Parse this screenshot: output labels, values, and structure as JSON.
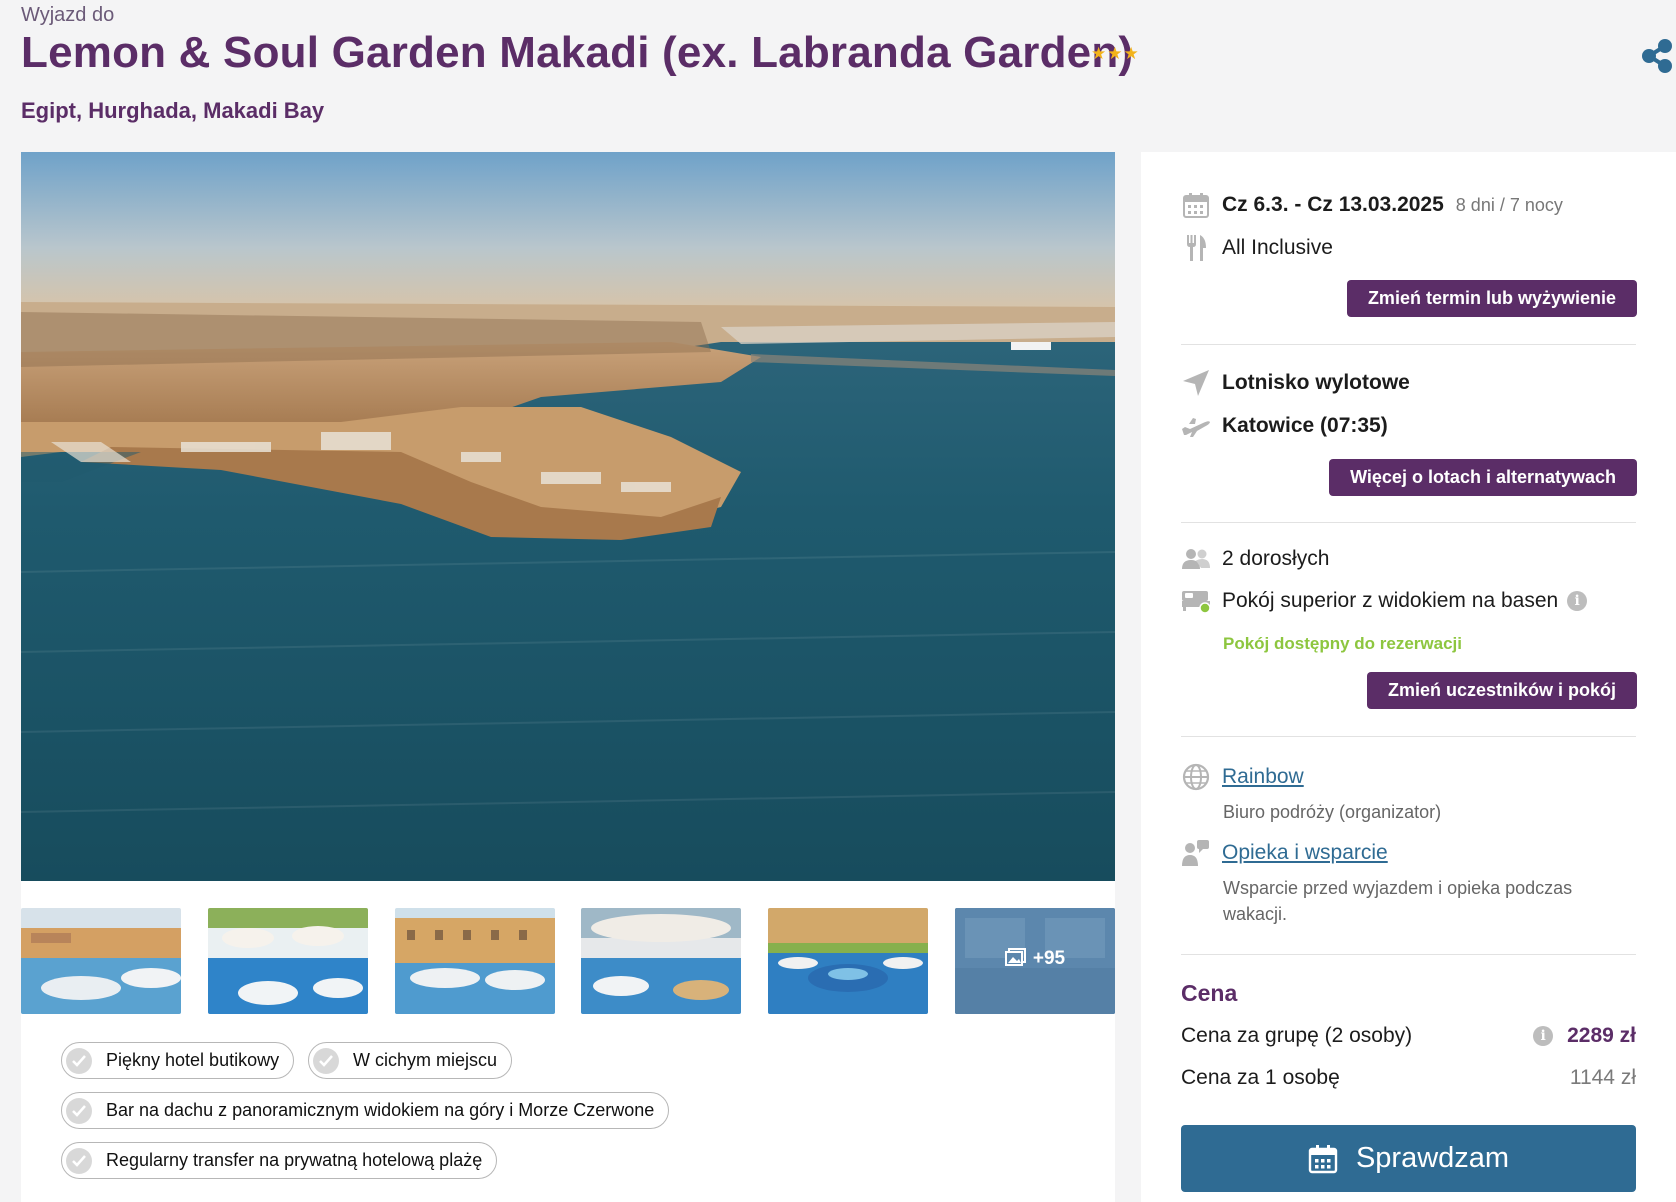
{
  "header": {
    "subtitle": "Wyjazd do",
    "title": "Lemon & Soul Garden Makadi (ex. Labranda Garden)",
    "stars": "★★★",
    "location": "Egipt, Hurghada, Makadi Bay",
    "share_icon": "share-icon"
  },
  "gallery": {
    "more_count": "+95",
    "tags": [
      "Piękny hotel butikowy",
      "W cichym miejscu",
      "Bar na dachu z panoramicznym widokiem na góry i Morze Czerwone",
      "Regularny transfer na prywatną hotelową plażę"
    ]
  },
  "booking": {
    "dates": "Cz 6.3. - Cz 13.03.2025",
    "duration": "8 dni / 7 nocy",
    "board": "All Inclusive",
    "change_term_button": "Zmień termin lub wyżywienie",
    "airport_label": "Lotnisko wylotowe",
    "airport_value": "Katowice (07:35)",
    "flights_button": "Więcej o lotach i alternatywach",
    "participants": "2 dorosłych",
    "room": "Pokój superior z widokiem na basen",
    "room_status": "Pokój dostępny do rezerwacji",
    "change_participants_button": "Zmień uczestników i pokój",
    "organizer_name": "Rainbow",
    "organizer_desc": "Biuro podróży (organizator)",
    "support_link": "Opieka i wsparcie",
    "support_desc": "Wsparcie przed wyjazdem i opieka podczas wakacji."
  },
  "price": {
    "heading": "Cena",
    "group_label": "Cena za grupę (2 osoby)",
    "group_value": "2289 zł",
    "person_label": "Cena za 1 osobę",
    "person_value": "1144 zł",
    "cta": "Sprawdzam"
  },
  "colors": {
    "brand_purple": "#5b2d67",
    "cta_blue": "#2f6b93",
    "available_green": "#8dc63f",
    "star_gold": "#f2b31b"
  }
}
